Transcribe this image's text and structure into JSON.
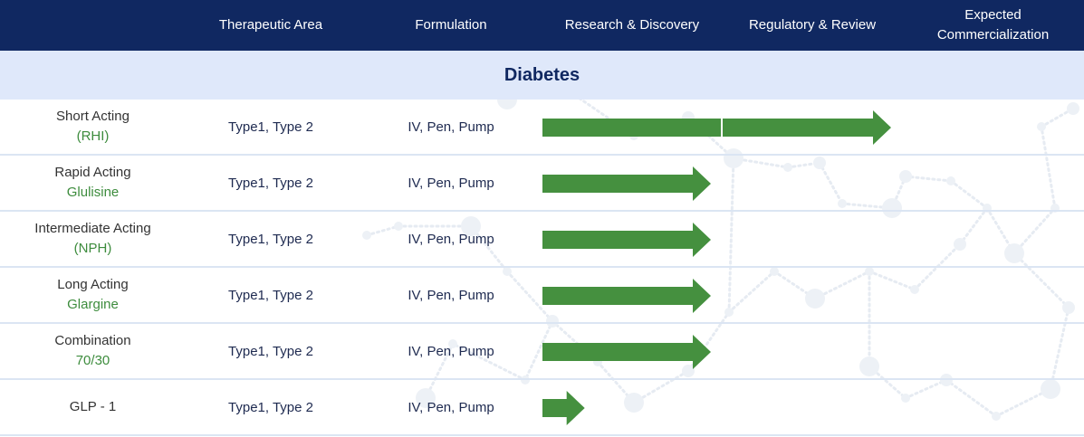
{
  "header": {
    "columns": [
      {
        "label": ""
      },
      {
        "label": "Therapeutic Area"
      },
      {
        "label": "Formulation"
      },
      {
        "label": "Research & Discovery"
      },
      {
        "label": "Regulatory & Review"
      },
      {
        "label": "Expected\nCommercialization"
      }
    ]
  },
  "section": {
    "title": "Diabetes"
  },
  "rows": [
    {
      "name": "Short Acting",
      "sub": "(RHI)",
      "area": "Type1, Type 2",
      "formulation": "IV, Pen, Pump"
    },
    {
      "name": "Rapid Acting",
      "sub": "Glulisine",
      "area": "Type1, Type 2",
      "formulation": "IV, Pen, Pump"
    },
    {
      "name": "Intermediate Acting",
      "sub": "(NPH)",
      "area": "Type1, Type 2",
      "formulation": "IV, Pen, Pump"
    },
    {
      "name": "Long Acting",
      "sub": "Glargine",
      "area": "Type1, Type 2",
      "formulation": "IV, Pen, Pump"
    },
    {
      "name": "Combination",
      "sub": "70/30",
      "area": "Type1, Type 2",
      "formulation": "IV, Pen, Pump"
    },
    {
      "name": "GLP - 1",
      "sub": "",
      "area": "Type1, Type 2",
      "formulation": "IV, Pen, Pump"
    }
  ],
  "chart_data": {
    "type": "bar",
    "orientation": "horizontal",
    "stages": [
      "Research & Discovery",
      "Regulatory & Review",
      "Expected Commercialization"
    ],
    "categories": [
      "Short Acting (RHI)",
      "Rapid Acting Glulisine",
      "Intermediate Acting (NPH)",
      "Long Acting Glargine",
      "Combination 70/30",
      "GLP - 1"
    ],
    "values": [
      2.0,
      1.0,
      1.0,
      1.0,
      1.0,
      0.3
    ],
    "xlim": [
      0,
      3
    ],
    "color": "#45903f"
  },
  "colors": {
    "header_bg": "#102861",
    "section_bg": "#dfe8fa",
    "bar": "#45903f",
    "sub_label": "#3d8c3d"
  }
}
